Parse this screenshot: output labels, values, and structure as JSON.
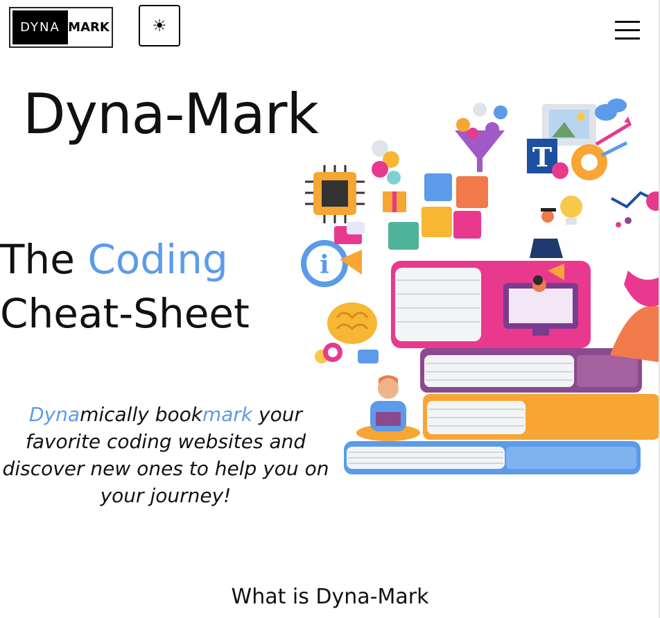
{
  "header": {
    "logo_left": "DYNA",
    "logo_right": "MARK",
    "theme_icon": "☀",
    "menu_icon": "hamburger-menu-icon"
  },
  "hero": {
    "site_title": "Dyna-Mark",
    "headline_the": "The",
    "headline_accent": "Coding",
    "headline_rest": "Cheat-Sheet",
    "tagline_part1": "Dyna",
    "tagline_part2": "mically book",
    "tagline_part3": "mark",
    "tagline_part4": " your favorite coding websites and discover new ones to help you on your journey!",
    "image_subject": "books-learning-illustration"
  },
  "section": {
    "title": "What is Dyna-Mark"
  },
  "colors": {
    "accent": "#5b9bea",
    "pink": "#e8398f",
    "purple": "#8b4a8f",
    "orange": "#f7a533",
    "blue": "#5b9bea"
  }
}
